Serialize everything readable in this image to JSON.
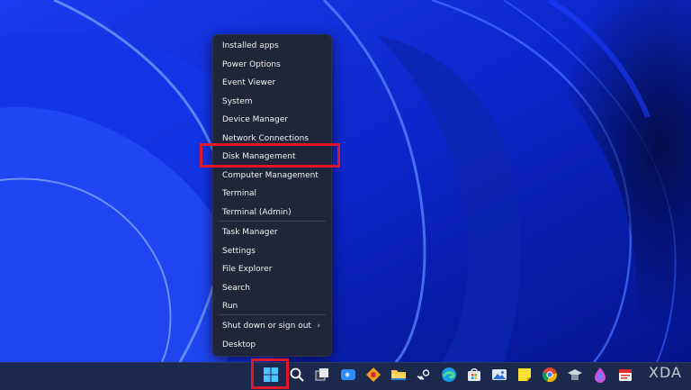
{
  "context_menu": {
    "items": [
      {
        "label": "Installed apps",
        "name": "menu-item-installed-apps"
      },
      {
        "label": "Power Options",
        "name": "menu-item-power-options"
      },
      {
        "label": "Event Viewer",
        "name": "menu-item-event-viewer"
      },
      {
        "label": "System",
        "name": "menu-item-system"
      },
      {
        "label": "Device Manager",
        "name": "menu-item-device-manager"
      },
      {
        "label": "Network Connections",
        "name": "menu-item-network-connections"
      },
      {
        "label": "Disk Management",
        "name": "menu-item-disk-management"
      },
      {
        "label": "Computer Management",
        "name": "menu-item-computer-management"
      },
      {
        "label": "Terminal",
        "name": "menu-item-terminal"
      },
      {
        "label": "Terminal (Admin)",
        "name": "menu-item-terminal-admin"
      },
      {
        "label": "Task Manager",
        "name": "menu-item-task-manager"
      },
      {
        "label": "Settings",
        "name": "menu-item-settings"
      },
      {
        "label": "File Explorer",
        "name": "menu-item-file-explorer"
      },
      {
        "label": "Search",
        "name": "menu-item-search"
      },
      {
        "label": "Run",
        "name": "menu-item-run"
      },
      {
        "label": "Shut down or sign out",
        "name": "menu-item-shut-down",
        "submenu": true
      },
      {
        "label": "Desktop",
        "name": "menu-item-desktop"
      }
    ],
    "highlighted_item": "Disk Management"
  },
  "taskbar": {
    "icons": [
      "start-icon",
      "search-icon",
      "task-view-icon",
      "widgets-icon",
      "app-icon",
      "file-explorer-icon",
      "steam-icon",
      "edge-icon",
      "store-icon",
      "photos-icon",
      "sticky-notes-icon",
      "chrome-icon",
      "app-icon-2",
      "app-icon-3",
      "app-icon-4"
    ]
  },
  "watermark": {
    "text": "XDA"
  },
  "colors": {
    "highlight": "#e0162b",
    "menu_bg": "#20263a",
    "wallpaper_blue": "#0a1fa8",
    "taskbar_bg": "#1b2a4c"
  }
}
